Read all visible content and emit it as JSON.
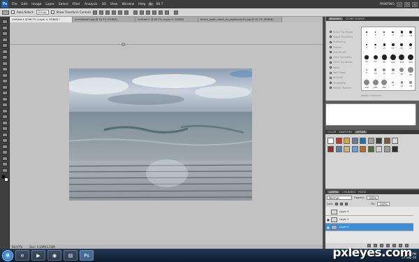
{
  "app": {
    "logo": "Ps",
    "menu": [
      "File",
      "Edit",
      "Image",
      "Layer",
      "Select",
      "Filter",
      "Analysis",
      "3D",
      "View",
      "Window",
      "Help"
    ],
    "workspace": "PAINTING",
    "zoom": "66.7"
  },
  "options_bar": {
    "auto_select_label": "Auto-Select:",
    "auto_select_value": "Group",
    "transform_label": "Show Transform Controls"
  },
  "tabs": [
    {
      "label": "Untitled-1 @ 66.7% (Layer 0, RGB/8) *"
    },
    {
      "label": "oceanbeach.jpg @ 16.7% (RGB/8)"
    },
    {
      "label": "Untitled-1 @ 66.7% (Layer 4, RGB/8)"
    },
    {
      "label": "beach_water_stock_by_bowlsocks01.jpg @ 15.7% (RGB/8)"
    }
  ],
  "status": {
    "zoom": "66.67%",
    "doc": "Doc: 1.03M/3.53M"
  },
  "brushes_panel": {
    "tabs": [
      "BRUSHES",
      "CLONE SOURCE"
    ],
    "options": [
      "Brush Tip Shape",
      "Shape Dynamics",
      "Scattering",
      "Texture",
      "Dual Brush",
      "Color Dynamics",
      "Other Dynamics",
      "Noise",
      "Wet Edges",
      "Airbrush",
      "Smoothing",
      "Protect Texture"
    ],
    "footer": "Master Diameter",
    "sizes": [
      "1",
      "3",
      "5",
      "9",
      "13",
      "19",
      "5",
      "9",
      "13",
      "17",
      "21",
      "27",
      "35",
      "45",
      "65",
      "100",
      "200",
      "300",
      "9",
      "13",
      "19",
      "17",
      "45",
      "65",
      "100",
      "200",
      "300",
      "9",
      "13",
      "19"
    ]
  },
  "styles_panel": {
    "tabs": [
      "COLOR",
      "SWATCHES",
      "STYLES"
    ],
    "swatch_colors": [
      "#ffffff",
      "#c0392b",
      "#d9a441",
      "#6c7a89",
      "#1f6fb2",
      "#a0a0a0",
      "#3d3d3d",
      "#7b5b3a",
      "#d8d8d8",
      "#8c2f2f",
      "#5b7f9b",
      "#c9b27c",
      "#6aa1d8",
      "#b96b2c",
      "#4c6b3f",
      "#cfcfcf",
      "#9a9a9a",
      "#2e2e2e"
    ]
  },
  "layers_panel": {
    "tabs": [
      "LAYERS",
      "CHANNELS",
      "PATHS"
    ],
    "blend_mode": "Normal",
    "opacity_label": "Opacity:",
    "opacity": "100%",
    "lock_label": "Lock:",
    "fill_label": "Fill:",
    "fill": "100%",
    "layers": [
      {
        "name": "Layer 3",
        "visible": false,
        "active": false
      },
      {
        "name": "Layer 1",
        "visible": true,
        "active": false
      },
      {
        "name": "Layer 0",
        "visible": true,
        "active": true
      }
    ]
  },
  "taskbar": {
    "clock_time": "7:15 PM",
    "clock_date": "27-Sep-10",
    "apps": [
      "ie-icon",
      "media-icon",
      "firefox-icon",
      "folder-icon",
      "photoshop-icon"
    ]
  },
  "watermark": "pxleyes.com"
}
